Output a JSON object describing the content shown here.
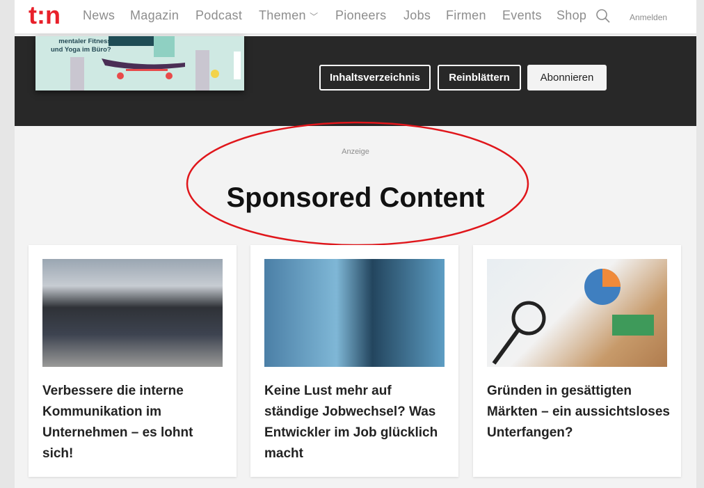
{
  "header": {
    "logo": "t3n",
    "nav": [
      {
        "label": "News"
      },
      {
        "label": "Magazin"
      },
      {
        "label": "Podcast"
      },
      {
        "label": "Themen"
      },
      {
        "label": "Pioneers"
      },
      {
        "label": "Jobs"
      },
      {
        "label": "Firmen"
      },
      {
        "label": "Events"
      },
      {
        "label": "Shop"
      }
    ],
    "login": "Anmelden"
  },
  "magazine": {
    "cover_text": "mentaler Fitness\nund Yoga im Büro?",
    "buttons": [
      "Inhaltsverzeichnis",
      "Reinblättern",
      "Abonnieren"
    ]
  },
  "sponsored": {
    "label": "Anzeige",
    "title": "Sponsored Content",
    "annotation_color": "#e0161b",
    "cards": [
      {
        "title": "Verbessere die interne Kommunikation im Unternehmen – es lohnt sich!"
      },
      {
        "title": "Keine Lust mehr auf ständige Jobwechsel? Was Entwickler im Job glücklich macht"
      },
      {
        "title": "Gründen in gesättigten Märkten – ein aussichtsloses Unterfangen?"
      }
    ]
  },
  "colors": {
    "brand": "#e8202a",
    "dark_band": "#282828"
  }
}
